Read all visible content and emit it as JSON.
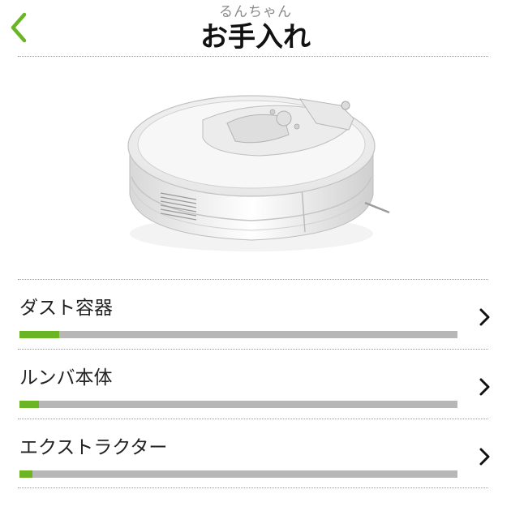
{
  "header": {
    "subtitle": "るんちゃん",
    "title": "お手入れ",
    "back_icon": "chevron-left-icon",
    "accent_color": "#6bb524"
  },
  "main": {
    "image": "robot-vacuum",
    "items": [
      {
        "label": "ダスト容器",
        "progress": 0.09,
        "icon": "chevron-right-icon"
      },
      {
        "label": "ルンバ本体",
        "progress": 0.045,
        "icon": "chevron-right-icon"
      },
      {
        "label": "エクストラクター",
        "progress": 0.03,
        "icon": "chevron-right-icon"
      }
    ]
  },
  "colors": {
    "accent": "#6bb524",
    "bar_track": "#b7b7b7",
    "divider": "#9a9a9a"
  }
}
